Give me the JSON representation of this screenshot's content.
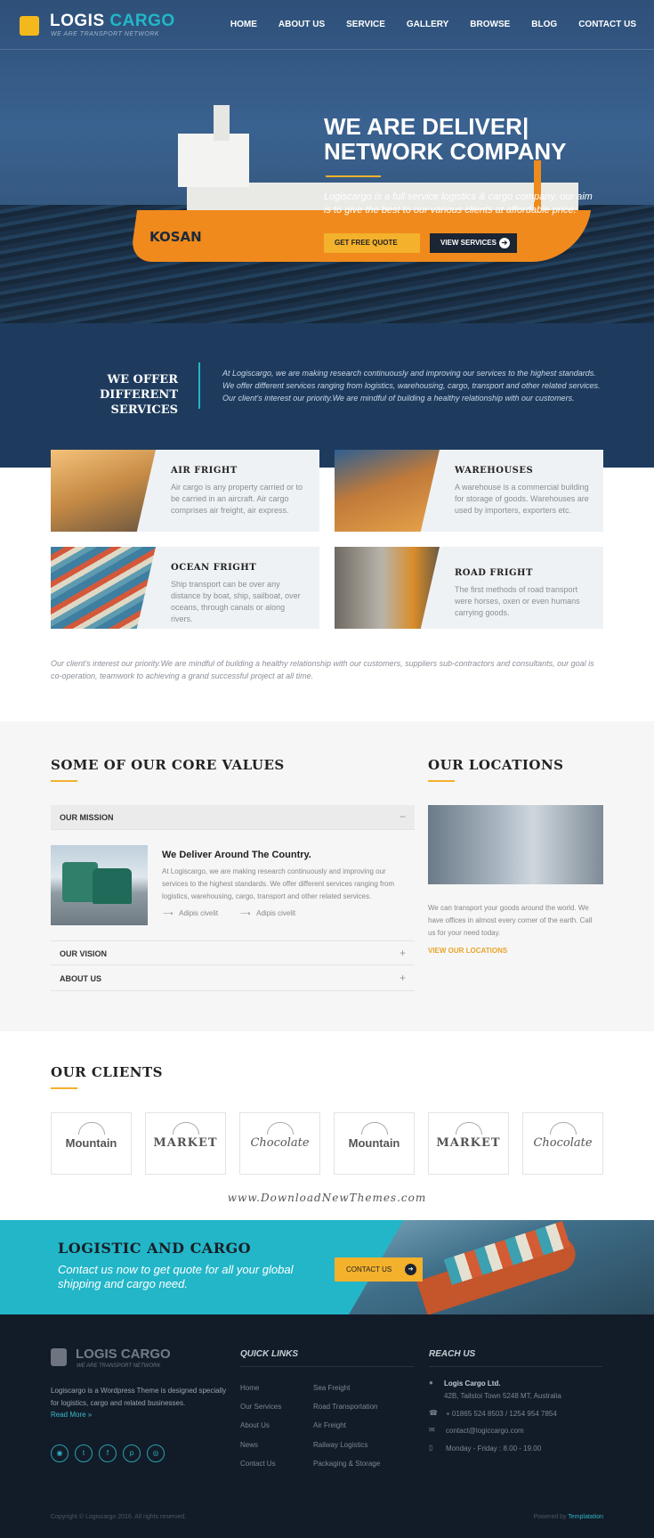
{
  "header": {
    "logo_part1": "LOGIS",
    "logo_part2": "CARGO",
    "tagline": "WE ARE TRANSPORT NETWORK",
    "nav": [
      "HOME",
      "ABOUT US",
      "SERVICE",
      "GALLERY",
      "BROWSE",
      "BLOG",
      "CONTACT US"
    ]
  },
  "hero": {
    "title_line1": "WE ARE DELIVER|",
    "title_line2": "NETWORK COMPANY",
    "text": "Logiscargo is a full service logistics & cargo company, our aim is to give the best to our various clients at affordable price.",
    "ship_name": "KOSAN",
    "btn_quote": "GET FREE QUOTE",
    "btn_view": "VIEW SERVICES"
  },
  "offer": {
    "title_line1": "WE OFFER",
    "title_line2": "DIFFERENT SERVICES",
    "text": "At Logiscargo, we are making research continuously and improving our services to the highest standards. We offer different services ranging from logistics, warehousing, cargo, transport and other related services. Our client's interest our priority.We are mindful of building a healthy relationship with our customers."
  },
  "services": [
    {
      "title": "AIR FRIGHT",
      "text": "Air cargo is any property carried or to be carried in an aircraft. Air cargo comprises air freight, air express.",
      "icon": "airplane-icon",
      "color": "#c9a06a"
    },
    {
      "title": "WAREHOUSES",
      "text": "A warehouse is a commercial building for storage of goods. Warehouses are used by importers, exporters etc.",
      "icon": "warehouse-icon",
      "color": "#b27a3a"
    },
    {
      "title": "OCEAN FRIGHT",
      "text": "Ship transport can be over any distance by boat, ship, sailboat, over oceans, through canals or along rivers.",
      "icon": "ship-icon",
      "color": "#4d7d95"
    },
    {
      "title": "ROAD FRIGHT",
      "text": "The first methods of road transport were horses, oxen or even humans carrying goods.",
      "icon": "truck-icon",
      "color": "#6f6452"
    }
  ],
  "services_note": "Our client's interest our priority.We are mindful of building a healthy relationship with our customers, suppliers sub-contractors and consultants, our goal is co-operation, teamwork to achieving a grand successful project at all time.",
  "core": {
    "title": "SOME OF OUR CORE VALUES",
    "accordion": [
      {
        "label": "OUR MISSION",
        "toggle": "−"
      },
      {
        "label": "OUR VISION",
        "toggle": "+"
      },
      {
        "label": "ABOUT US",
        "toggle": "+"
      }
    ],
    "mission_heading": "We Deliver Around The Country.",
    "mission_text": "At Logiscargo, we are making research continuously and improving our services to the highest standards. We offer different services ranging from logistics, warehousing, cargo, transport and other related services.",
    "bullets": [
      "Adipis civelit",
      "Adipis civelit"
    ]
  },
  "locations": {
    "title": "OUR LOCATIONS",
    "text": "We can transport your goods around the world. We have offices in almost every corner of the earth. Call us for your need today.",
    "link": "VIEW OUR LOCATIONS"
  },
  "clients": {
    "title": "OUR CLIENTS",
    "logos": [
      "Mountain",
      "MARKET",
      "Chocolate",
      "Mountain",
      "MARKET",
      "Chocolate"
    ]
  },
  "watermark": "www.DownloadNewThemes.com",
  "cta": {
    "title": "LOGISTIC AND CARGO",
    "text": "Contact us now to get quote for all your global shipping and cargo need.",
    "button": "CONTACT US"
  },
  "footer": {
    "logo_part1": "LOGIS",
    "logo_part2": "CARGO",
    "tagline": "WE ARE TRANSPORT NETWORK",
    "about": "Logiscargo is a Wordpress Theme is designed specially for logistics, cargo and related businesses.",
    "read_more": "Read More »",
    "social": [
      "rss-icon",
      "twitter-icon",
      "facebook-icon",
      "pinterest-icon",
      "instagram-icon"
    ],
    "quick_links_title": "QUICK LINKS",
    "links_col1": [
      "Home",
      "Our Services",
      "About Us",
      "News",
      "Contact Us"
    ],
    "links_col2": [
      "Sea Freight",
      "Road Transportation",
      "Air Freight",
      "Railway Logistics",
      "Packaging & Storage"
    ],
    "reach_title": "REACH US",
    "company": "Logis Cargo Ltd.",
    "address": "42B, Tailstoi Town 5248 MT, Australia",
    "phone": "+ 01865 524 8503 / 1254 954 7854",
    "email": "contact@logiccargo.com",
    "hours": "Monday - Friday : 8.00 - 19.00",
    "copyright": "Copyright © Logiscargo 2016. All rights reserved.",
    "powered_prefix": "Powered by",
    "powered_by": "Templatation"
  },
  "colors": {
    "accent": "#f3b12c",
    "teal": "#22b6c8",
    "navy": "#1e3b5e"
  }
}
